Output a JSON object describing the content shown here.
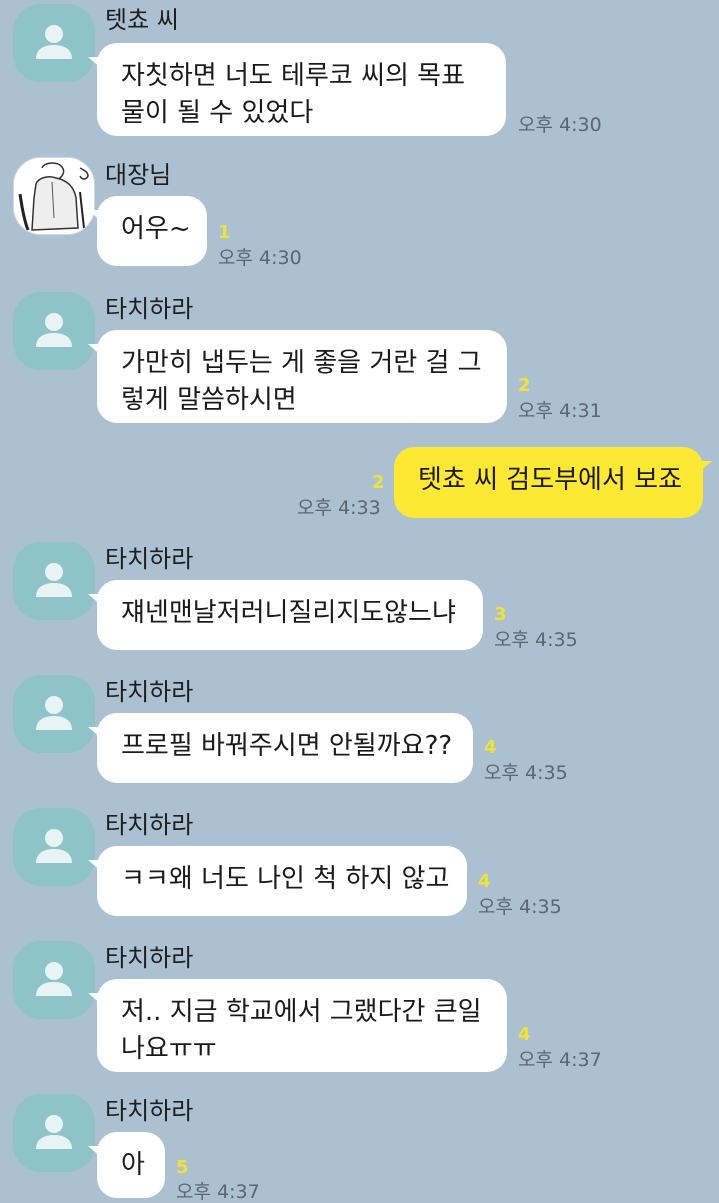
{
  "messages": [
    {
      "sender": "텟쵸 씨",
      "lines": [
        "자칫하면 너도 테루코 씨의 목표",
        "물이 될 수 있었다"
      ],
      "unread": "",
      "time": "오후 4:30"
    },
    {
      "sender": "대장님",
      "lines": [
        "어우~"
      ],
      "unread": "1",
      "time": "오후 4:30"
    },
    {
      "sender": "타치하라",
      "lines": [
        "가만히 냅두는 게 좋을 거란 걸 그",
        "렇게 말씀하시면"
      ],
      "unread": "2",
      "time": "오후 4:31"
    },
    {
      "sender": "",
      "lines": [
        "텟쵸 씨 검도부에서 보죠"
      ],
      "unread": "2",
      "time": "오후 4:33"
    },
    {
      "sender": "타치하라",
      "lines": [
        "쟤넨맨날저러니질리지도않느냐"
      ],
      "unread": "3",
      "time": "오후 4:35"
    },
    {
      "sender": "타치하라",
      "lines": [
        "프로필 바꿔주시면 안될까요??"
      ],
      "unread": "4",
      "time": "오후 4:35"
    },
    {
      "sender": "타치하라",
      "lines": [
        "ㅋㅋ왜 너도 나인 척 하지 않고"
      ],
      "unread": "4",
      "time": "오후 4:35"
    },
    {
      "sender": "타치하라",
      "lines": [
        "저.. 지금 학교에서 그랬다간 큰일",
        "나요ㅠㅠ"
      ],
      "unread": "4",
      "time": "오후 4:37"
    },
    {
      "sender": "타치하라",
      "lines": [
        "아"
      ],
      "unread": "5",
      "time": "오후 4:37"
    }
  ],
  "colors": {
    "background": "#abc1d1",
    "my_bubble": "#fde834",
    "other_bubble": "#ffffff",
    "unread_count": "#f3e13a",
    "default_avatar": "#8ec3c8"
  },
  "icons": {
    "default_avatar": "person-silhouette-icon",
    "custom_avatar": "sketch-drawing-avatar"
  }
}
